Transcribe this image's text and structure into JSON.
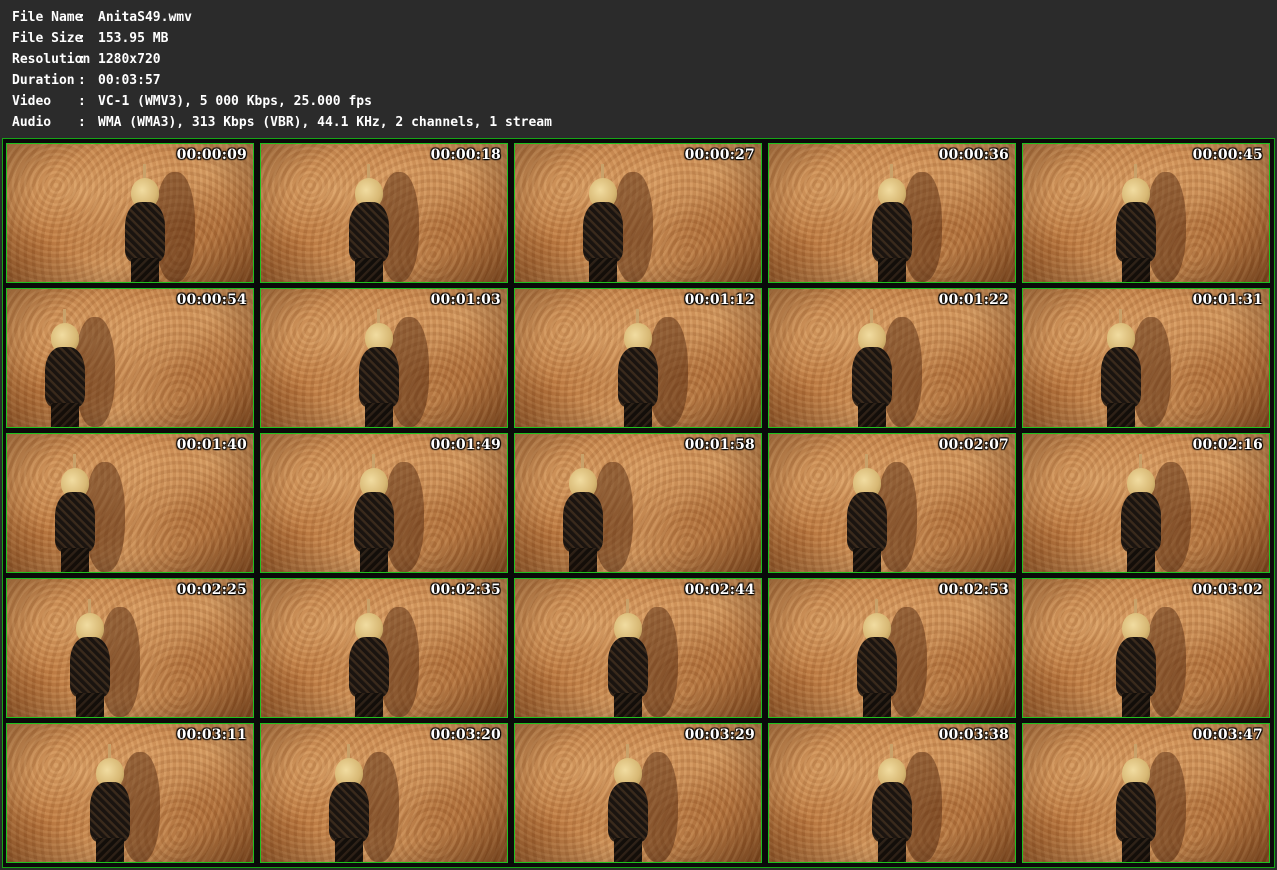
{
  "file_info": {
    "rows": [
      {
        "label": "File Name",
        "value": "AnitaS49.wmv"
      },
      {
        "label": "File Size",
        "value": "153.95 MB"
      },
      {
        "label": "Resolution",
        "value": "1280x720"
      },
      {
        "label": "Duration",
        "value": "00:03:57"
      },
      {
        "label": "Video",
        "value": "VC-1 (WMV3), 5 000 Kbps, 25.000 fps"
      },
      {
        "label": "Audio",
        "value": "WMA (WMA3), 313 Kbps (VBR), 44.1 KHz, 2 channels, 1 stream"
      }
    ],
    "separator": ":"
  },
  "thumbnails": [
    {
      "timestamp": "00:00:09"
    },
    {
      "timestamp": "00:00:18"
    },
    {
      "timestamp": "00:00:27"
    },
    {
      "timestamp": "00:00:36"
    },
    {
      "timestamp": "00:00:45"
    },
    {
      "timestamp": "00:00:54"
    },
    {
      "timestamp": "00:01:03"
    },
    {
      "timestamp": "00:01:12"
    },
    {
      "timestamp": "00:01:22"
    },
    {
      "timestamp": "00:01:31"
    },
    {
      "timestamp": "00:01:40"
    },
    {
      "timestamp": "00:01:49"
    },
    {
      "timestamp": "00:01:58"
    },
    {
      "timestamp": "00:02:07"
    },
    {
      "timestamp": "00:02:16"
    },
    {
      "timestamp": "00:02:25"
    },
    {
      "timestamp": "00:02:35"
    },
    {
      "timestamp": "00:02:44"
    },
    {
      "timestamp": "00:02:53"
    },
    {
      "timestamp": "00:03:02"
    },
    {
      "timestamp": "00:03:11"
    },
    {
      "timestamp": "00:03:20"
    },
    {
      "timestamp": "00:03:29"
    },
    {
      "timestamp": "00:03:38"
    },
    {
      "timestamp": "00:03:47"
    }
  ],
  "colors": {
    "background": "#2b2b2b",
    "grid_border": "#1fc01f",
    "text": "#ffffff"
  }
}
